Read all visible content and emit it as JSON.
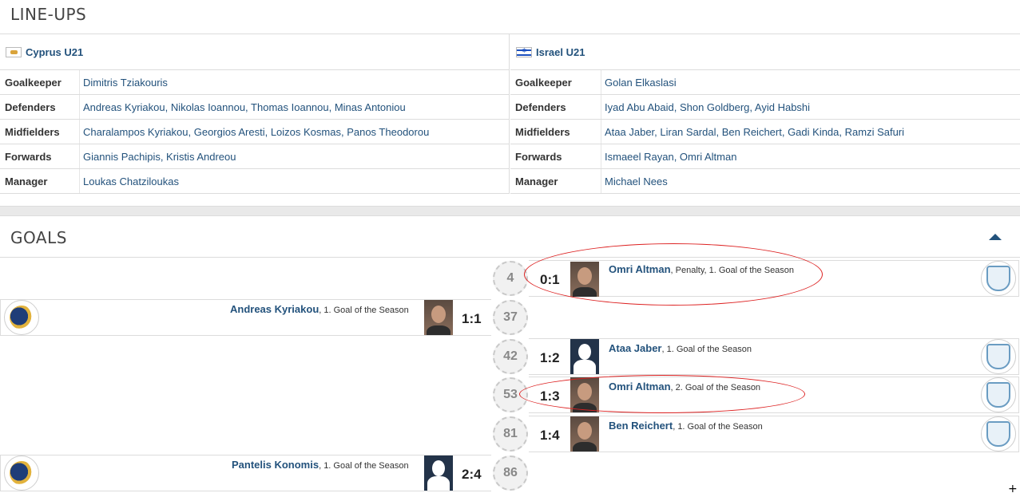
{
  "lineups": {
    "title": "LINE-UPS",
    "home": {
      "team": "Cyprus U21",
      "rows": [
        {
          "label": "Goalkeeper",
          "value": "Dimitris Tziakouris"
        },
        {
          "label": "Defenders",
          "value": "Andreas Kyriakou, Nikolas Ioannou, Thomas Ioannou, Minas Antoniou"
        },
        {
          "label": "Midfielders",
          "value": "Charalampos Kyriakou, Georgios Aresti, Loizos Kosmas, Panos Theodorou"
        },
        {
          "label": "Forwards",
          "value": "Giannis Pachipis, Kristis Andreou"
        },
        {
          "label": "Manager",
          "value": "Loukas Chatziloukas"
        }
      ]
    },
    "away": {
      "team": "Israel U21",
      "rows": [
        {
          "label": "Goalkeeper",
          "value": "Golan Elkaslasi"
        },
        {
          "label": "Defenders",
          "value": "Iyad Abu Abaid, Shon Goldberg, Ayid Habshi"
        },
        {
          "label": "Midfielders",
          "value": "Ataa Jaber, Liran Sardal, Ben Reichert, Gadi Kinda, Ramzi Safuri"
        },
        {
          "label": "Forwards",
          "value": "Ismaeel Rayan, Omri Altman"
        },
        {
          "label": "Manager",
          "value": "Michael Nees"
        }
      ]
    }
  },
  "goals": {
    "title": "GOALS",
    "items": [
      {
        "minute": "4",
        "score": "0:1",
        "scorer": "Omri Altman",
        "detail": ", Penalty, 1. Goal of the Season"
      },
      {
        "minute": "37",
        "score": "1:1",
        "scorer": "Andreas Kyriakou",
        "detail": ", 1. Goal of the Season"
      },
      {
        "minute": "42",
        "score": "1:2",
        "scorer": "Ataa Jaber",
        "detail": ", 1. Goal of the Season"
      },
      {
        "minute": "53",
        "score": "1:3",
        "scorer": "Omri Altman",
        "detail": ", 2. Goal of the Season"
      },
      {
        "minute": "81",
        "score": "1:4",
        "scorer": "Ben Reichert",
        "detail": ", 1. Goal of the Season"
      },
      {
        "minute": "86",
        "score": "2:4",
        "scorer": "Pantelis Konomis",
        "detail": ", 1. Goal of the Season"
      }
    ]
  },
  "colors": {
    "link": "#23527c",
    "annotation": "#dd2222"
  },
  "icons": {
    "collapse": "chevron-up-icon",
    "home_crest": "cyprus-federation-crest-icon",
    "away_crest": "israel-federation-crest-icon"
  }
}
